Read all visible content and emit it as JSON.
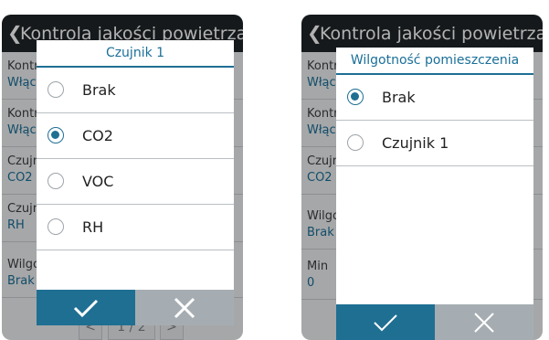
{
  "left_screen": {
    "header": {
      "back_icon": "chevron-left-icon",
      "title": "Kontrola jakości powietrza"
    },
    "background_items": [
      {
        "title": "Kontrola",
        "value": "Włączona"
      },
      {
        "title": "Kontrola",
        "value": "Włączona"
      },
      {
        "title": "Czujnik 1",
        "value": "CO2"
      },
      {
        "title": "Czujnik 2",
        "value": "RH"
      },
      {
        "title": "Wilgotność pomieszczenia",
        "value": "Brak"
      }
    ],
    "pager": {
      "prev": "<",
      "page": "1 / 2",
      "next": ">"
    },
    "dialog": {
      "title": "Czujnik 1",
      "options": [
        {
          "label": "Brak",
          "selected": false
        },
        {
          "label": "CO2",
          "selected": true
        },
        {
          "label": "VOC",
          "selected": false
        },
        {
          "label": "RH",
          "selected": false
        }
      ],
      "ok_icon": "checkmark-icon",
      "cancel_icon": "close-icon"
    }
  },
  "right_screen": {
    "header": {
      "back_icon": "chevron-left-icon",
      "title": "Kontrola jakości powietrza"
    },
    "background_items": [
      {
        "title": "Kontrola",
        "value": "Włączona"
      },
      {
        "title": "Kontrola",
        "value": "Włączona"
      },
      {
        "title": "Czujnik 1",
        "value": "CO2"
      },
      {
        "title": "Wilgotność",
        "value": "Brak"
      },
      {
        "title": "Min",
        "value": "0"
      }
    ],
    "dialog": {
      "title": "Wilgotność pomieszczenia",
      "options": [
        {
          "label": "Brak",
          "selected": true
        },
        {
          "label": "Czujnik 1",
          "selected": false
        }
      ],
      "ok_icon": "checkmark-icon",
      "cancel_icon": "close-icon"
    }
  },
  "colors": {
    "accent": "#1f6f93",
    "header_bg": "#1f2428",
    "cancel_bg": "#a6adb2"
  }
}
